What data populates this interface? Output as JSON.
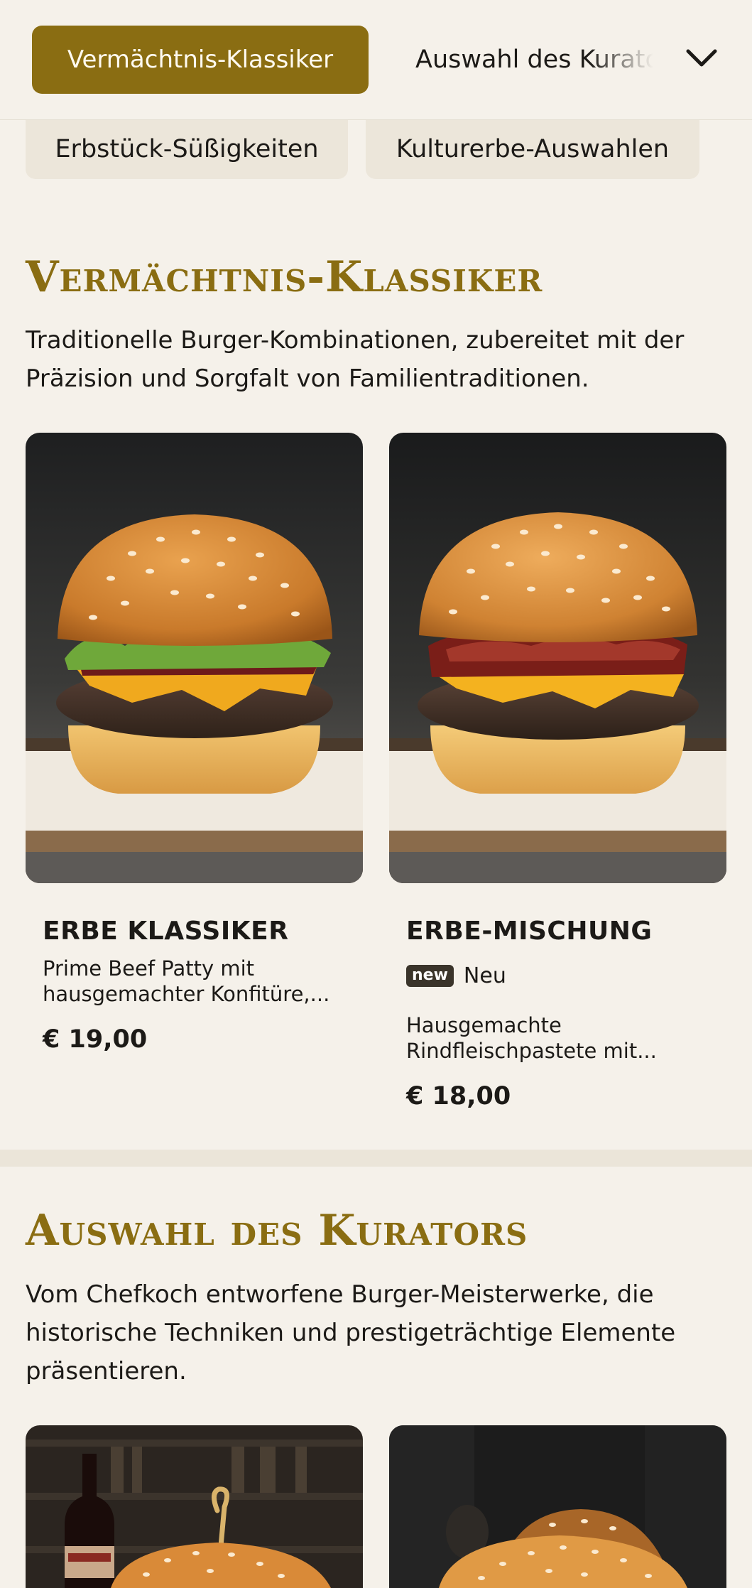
{
  "nav": {
    "active_category": "Vermächtnis-Klassiker",
    "next_category": "Auswahl des Kurators",
    "row2": [
      "Erbstück-Süßigkeiten",
      "Kulturerbe-Auswahlen"
    ],
    "chevron_icon": "chevron-down-icon"
  },
  "sections": [
    {
      "title": "Vermächtnis-Klassiker",
      "description": "Traditionelle Burger-Kombinationen, zubereitet mit der Präzision und Sorgfalt von Familientraditionen.",
      "items": [
        {
          "title": "ERBE KLASSIKER",
          "description": "Prime Beef Patty mit hausgemachter Konfitüre,...",
          "price": "€ 19,00"
        },
        {
          "title": "ERBE-MISCHUNG",
          "badge": "new",
          "badge_label": "Neu",
          "description": "Hausgemachte Rindfleischpastete mit...",
          "price": "€ 18,00"
        }
      ]
    },
    {
      "title": "Auswahl des Kurators",
      "description": "Vom Chefkoch entworfene Burger-Meisterwerke, die historische Techniken und prestigeträchtige Elemente präsentieren."
    }
  ],
  "colors": {
    "accent": "#8a6d12",
    "background": "#f5f1ea",
    "chip": "#ece6da",
    "text": "#1c1a17"
  }
}
